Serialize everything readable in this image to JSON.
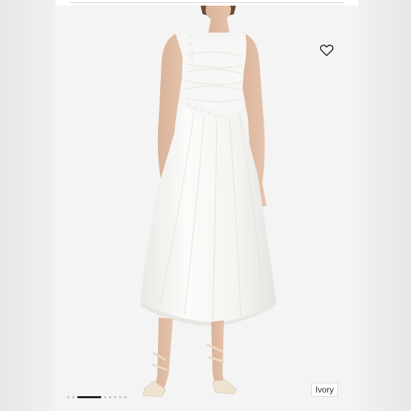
{
  "product": {
    "color_label": "Ivory"
  },
  "carousel": {
    "total_slides": 8,
    "active_index": 2
  },
  "icons": {
    "wishlist": "heart-outline-icon"
  },
  "colors": {
    "background": "#ececec",
    "photo_background": "#f4f4f4",
    "dress": "#f8f8f6",
    "accent_dark": "#222222"
  }
}
